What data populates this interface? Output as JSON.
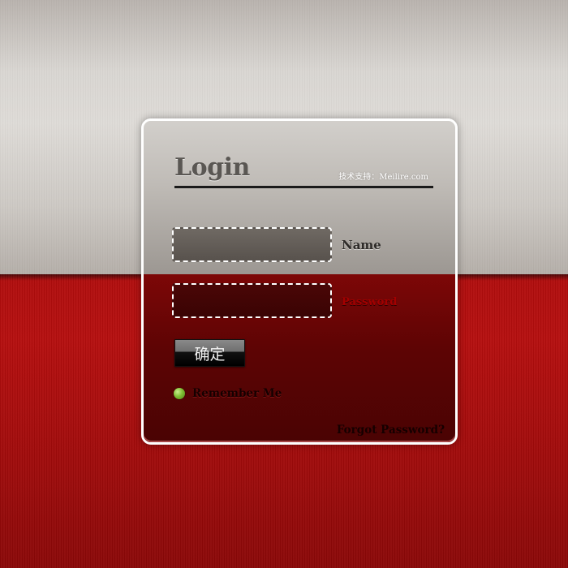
{
  "login": {
    "title": "Login",
    "credit": "技术支持：Meilire.com",
    "fields": {
      "name": {
        "label": "Name",
        "value": "",
        "placeholder": ""
      },
      "password": {
        "label": "Password",
        "value": "",
        "placeholder": ""
      }
    },
    "submit_label": "确定",
    "remember": {
      "label": "Remember Me",
      "checked": true,
      "indicator_color": "#7fbf34"
    },
    "forgot_label": "Forgot Password?"
  },
  "colors": {
    "accent_red": "#b10d0d",
    "light_gray": "#dedbd7",
    "panel_border": "#ffffff"
  },
  "icons": {
    "remember": "green-dot-icon"
  }
}
